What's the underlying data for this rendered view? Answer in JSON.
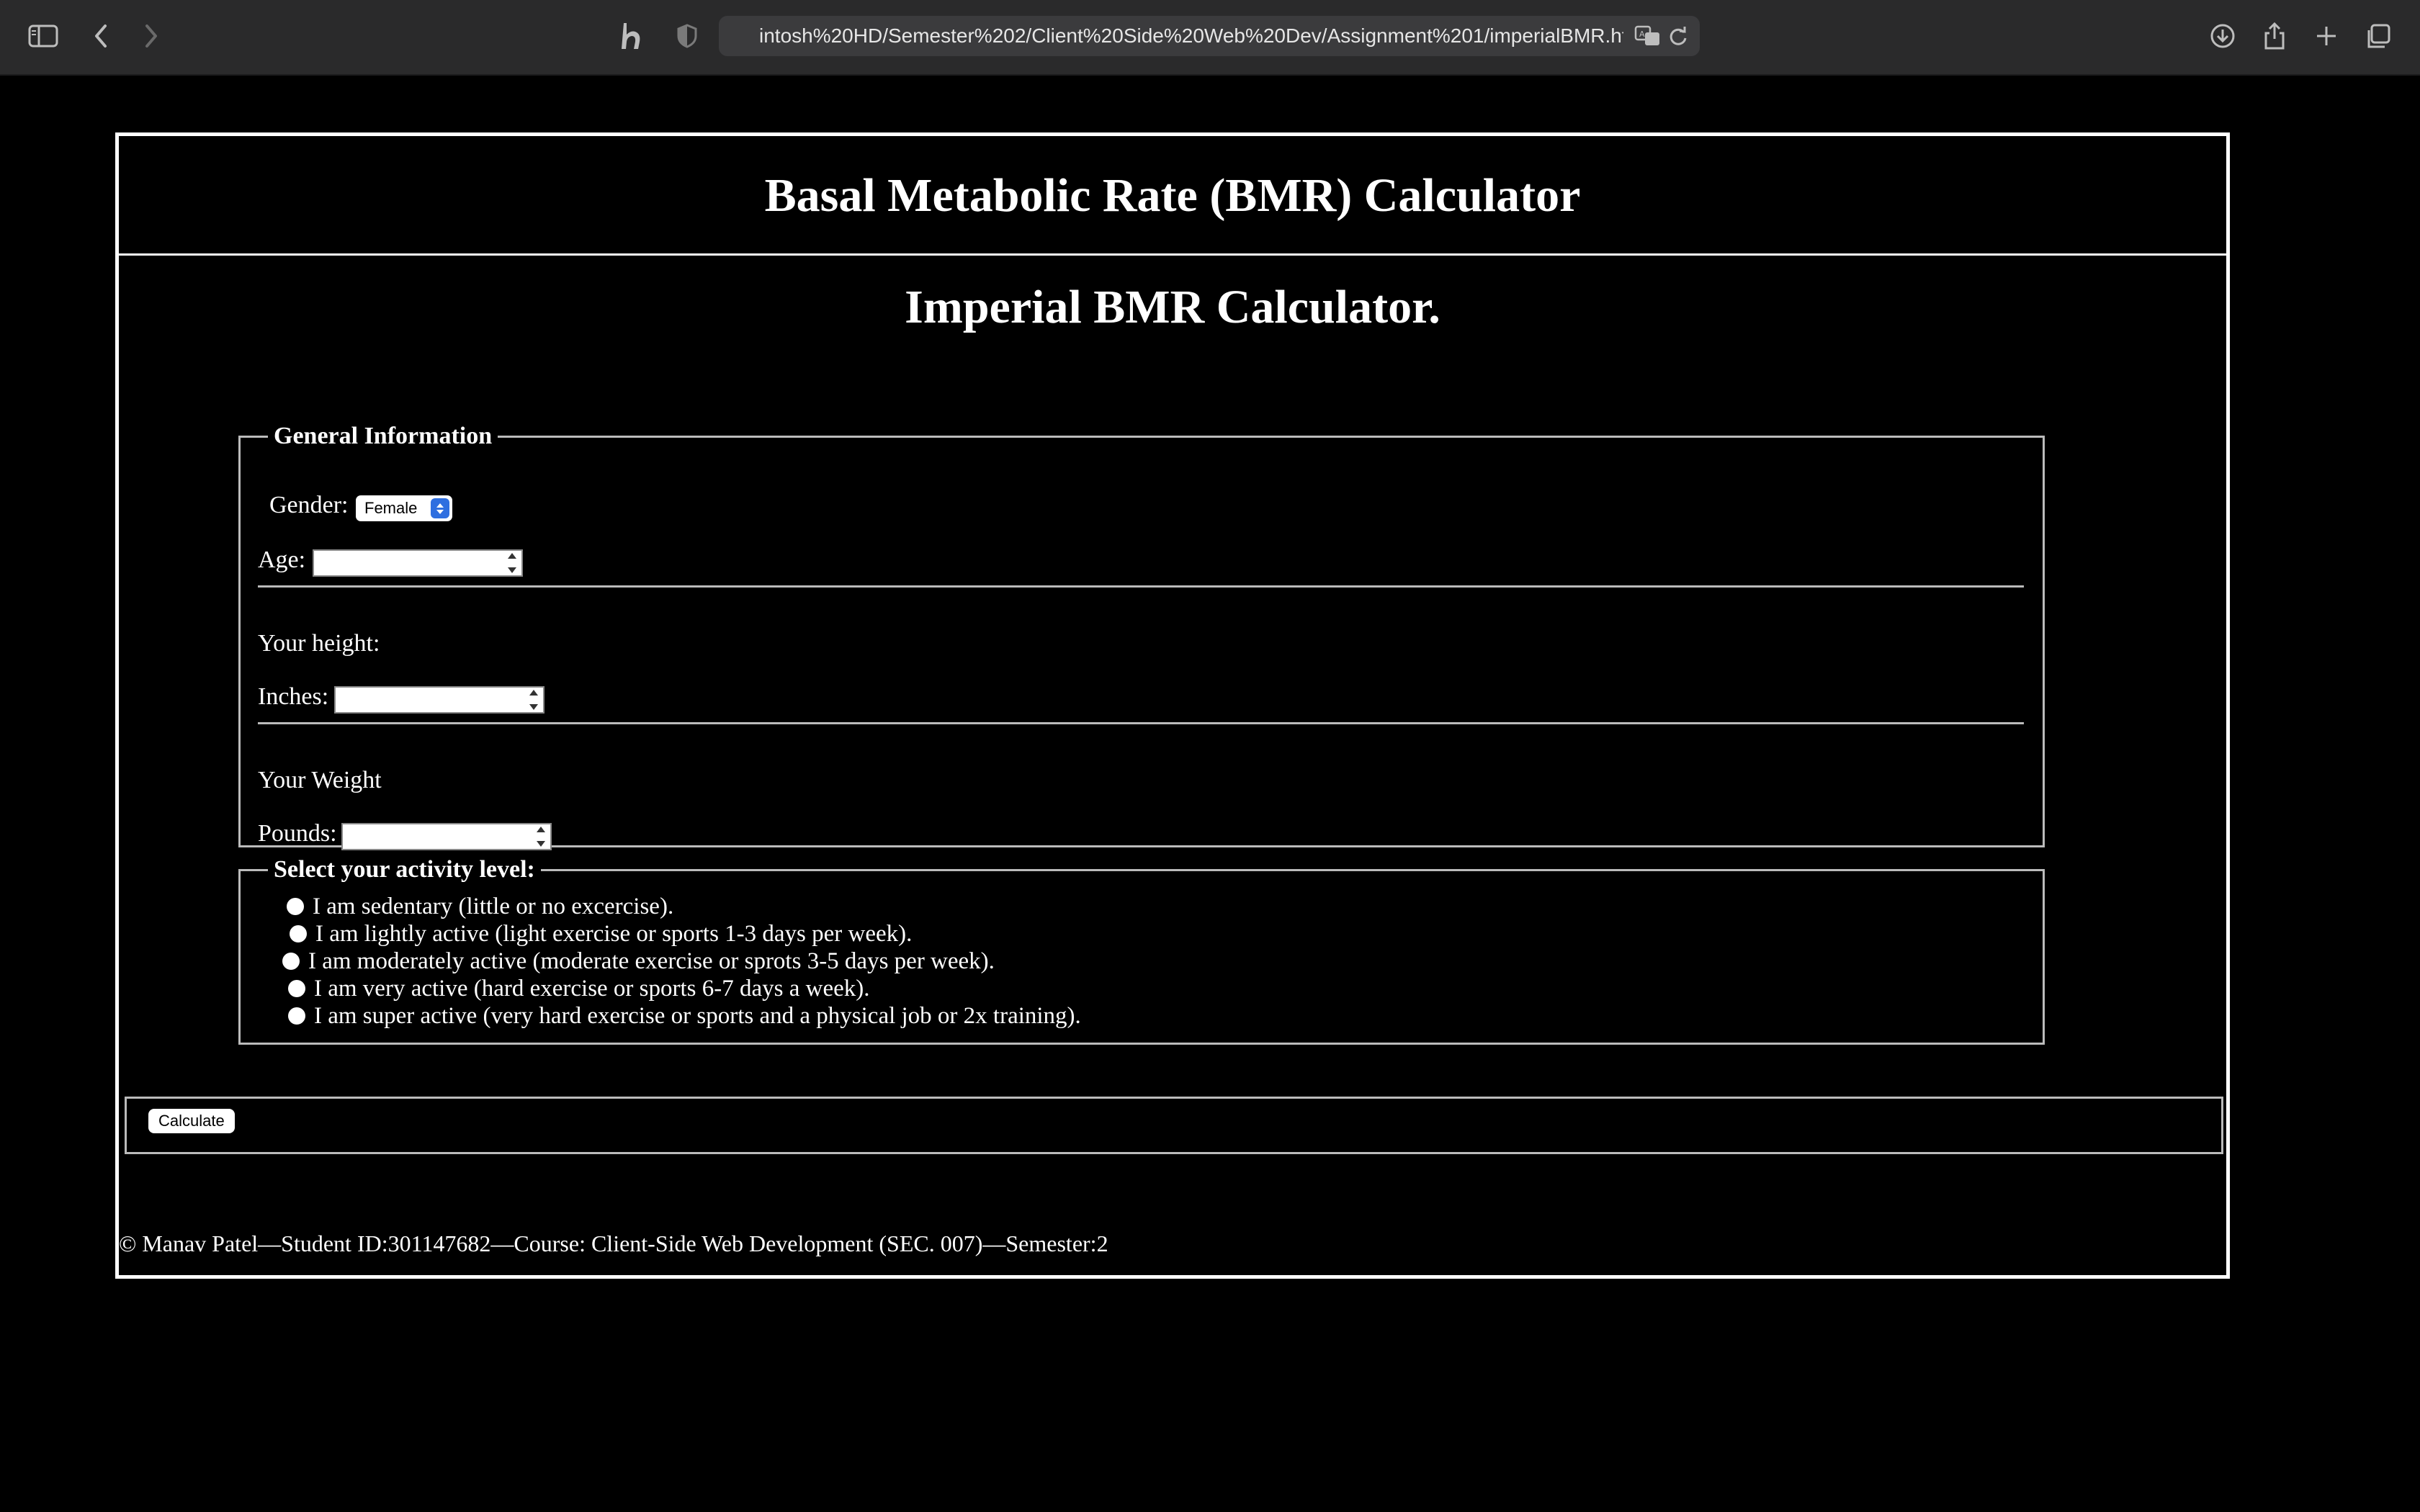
{
  "browser": {
    "url": "intosh%20HD/Semester%202/Client%20Side%20Web%20Dev/Assignment%201/imperialBMR.html"
  },
  "page": {
    "title": "Basal Metabolic Rate (BMR) Calculator",
    "subtitle": "Imperial BMR Calculator."
  },
  "general": {
    "legend": "General Information",
    "gender_label": "Gender:",
    "gender_value": "Female",
    "age_label": "Age:",
    "height_heading": "Your height:",
    "inches_label": "Inches:",
    "weight_heading": "Your Weight",
    "pounds_label": "Pounds:"
  },
  "activity": {
    "legend": "Select your activity level:",
    "options": [
      "I am sedentary (little or no excercise).",
      "I am lightly active (light exercise or sports 1-3 days per week).",
      "I am moderately active (moderate exercise or sprots 3-5 days per week).",
      "I am very active (hard exercise or sports 6-7 days a week).",
      "I am super active (very hard exercise or sports and a physical job or 2x training)."
    ]
  },
  "actions": {
    "calculate_label": "Calculate"
  },
  "footer": {
    "text": "© Manav Patel—Student ID:301147682—Course: Client-Side Web Development (SEC. 007)—Semester:2"
  }
}
